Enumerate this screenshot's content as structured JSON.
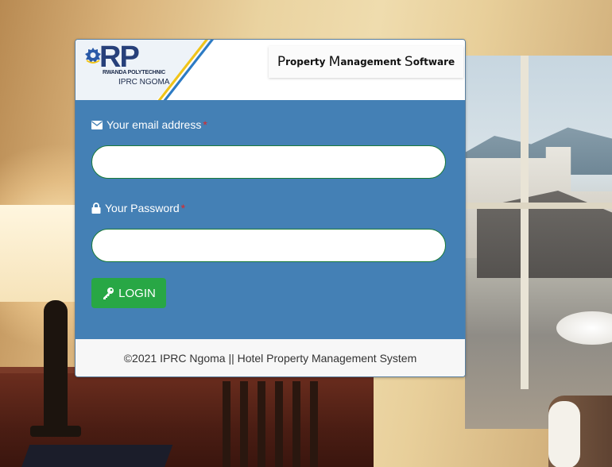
{
  "header": {
    "logo_text": "RP",
    "logo_sub1": "RWANDA POLYTECHNIC",
    "logo_sub2": "IPRC NGOMA",
    "title_parts": [
      {
        "big": "P",
        "small": "roperty "
      },
      {
        "big": "M",
        "small": "anagement "
      },
      {
        "big": "S",
        "small": "oftware"
      }
    ]
  },
  "form": {
    "email_label": "Your email address",
    "email_required": "*",
    "email_icon": "envelope-icon",
    "email_value": "",
    "password_label": "Your Password",
    "password_required": "*",
    "password_icon": "lock-icon",
    "password_value": "",
    "login_label": "LOGIN",
    "login_icon": "key-icon"
  },
  "footer": {
    "text": "©2021 IPRC Ngoma || Hotel Property Management System"
  },
  "colors": {
    "panel": "#4480b5",
    "button": "#28a745",
    "required": "#e02424"
  }
}
